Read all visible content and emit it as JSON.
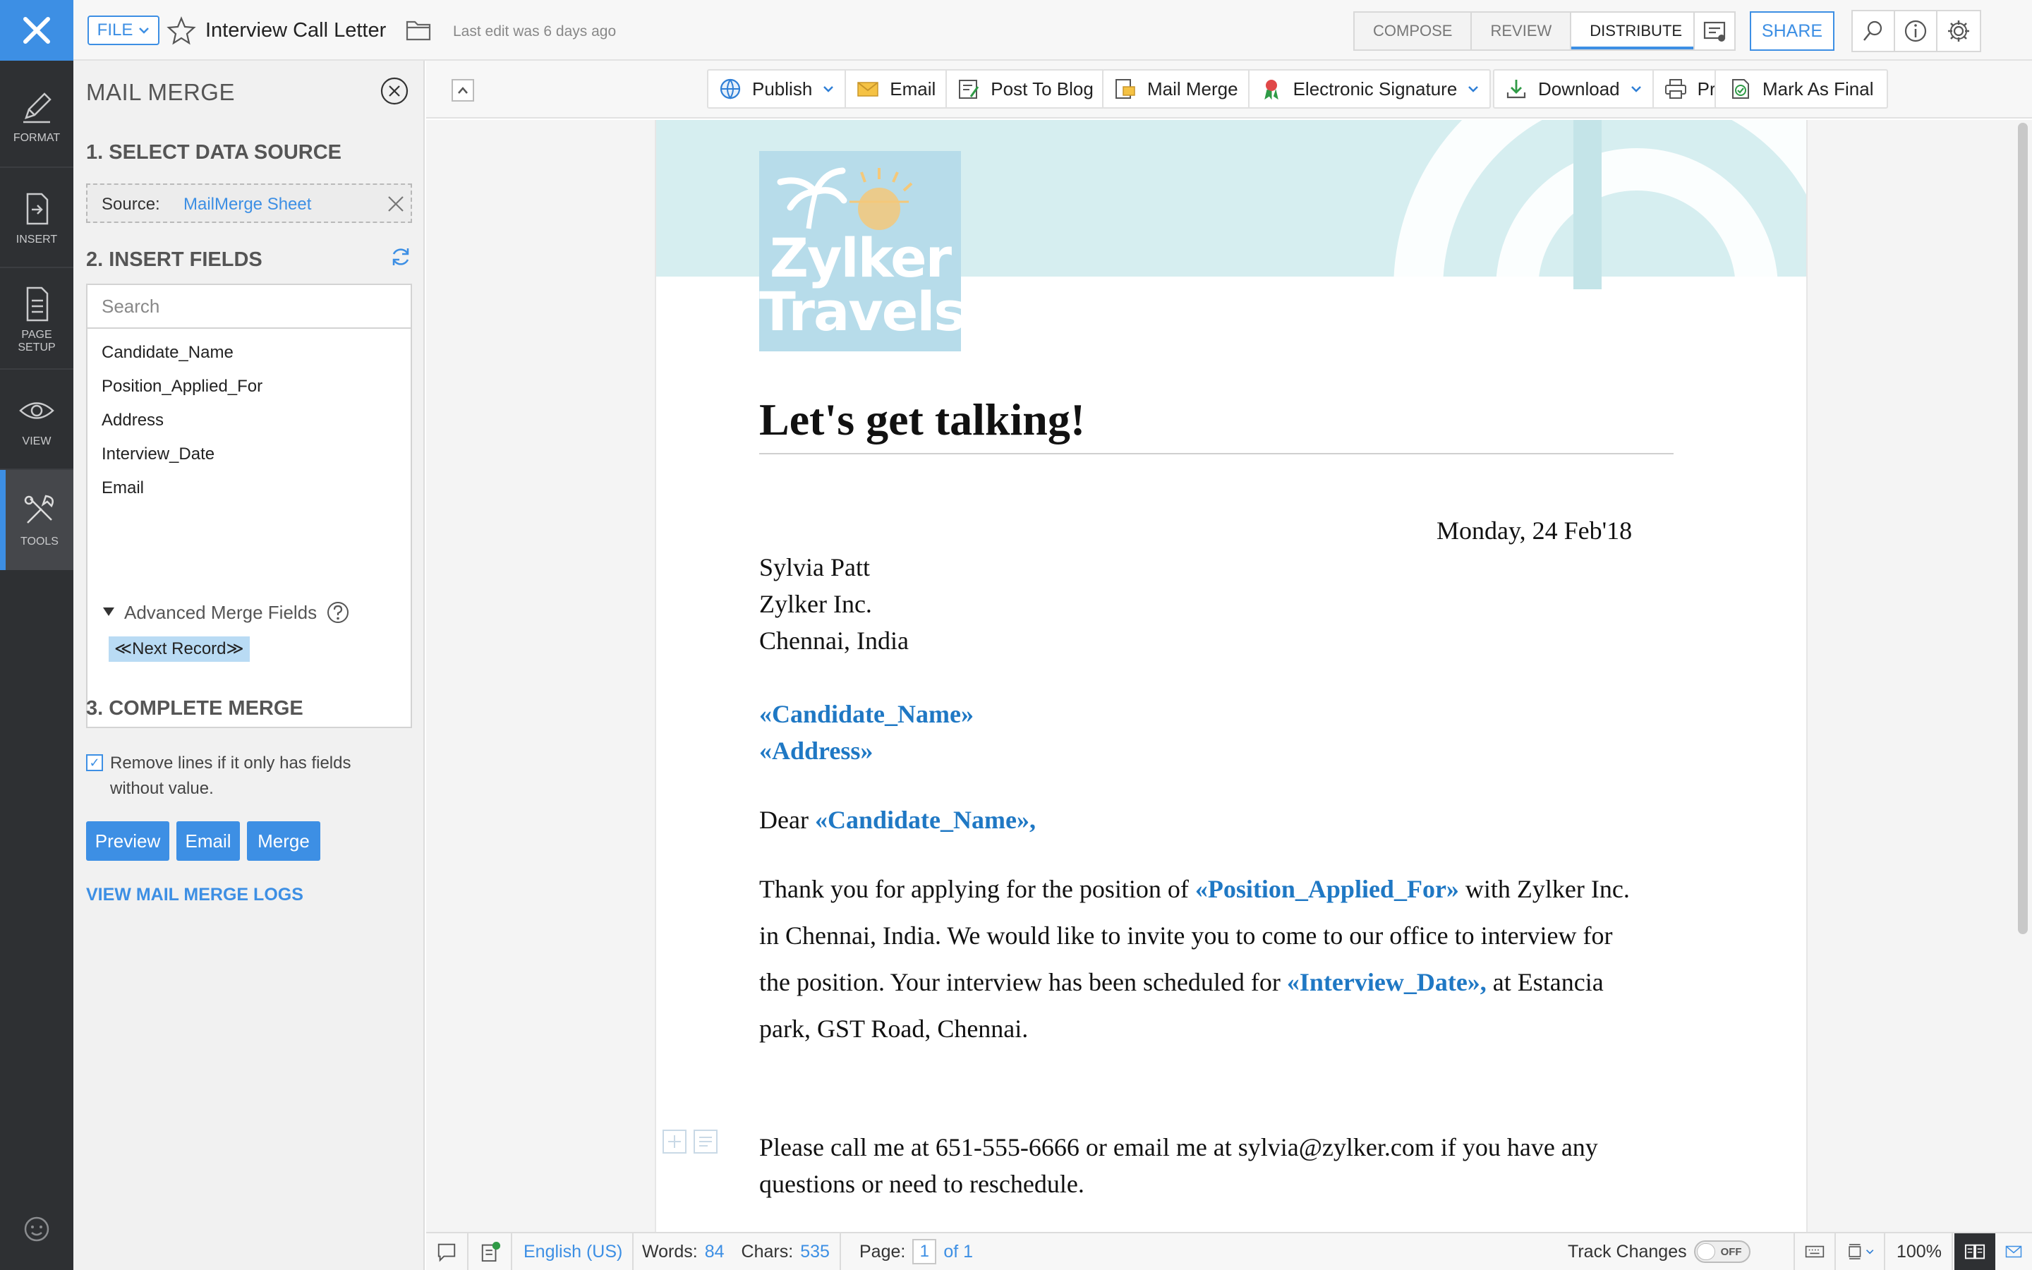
{
  "rail": {
    "items": [
      {
        "label": "FORMAT"
      },
      {
        "label": "INSERT"
      },
      {
        "label": "PAGE SETUP"
      },
      {
        "label": "VIEW"
      },
      {
        "label": "TOOLS"
      }
    ],
    "active": "TOOLS"
  },
  "header": {
    "file_label": "FILE",
    "doc_title": "Interview Call Letter",
    "last_edit": "Last edit was 6 days ago",
    "tabs": [
      {
        "label": "COMPOSE"
      },
      {
        "label": "REVIEW"
      },
      {
        "label": "DISTRIBUTE"
      }
    ],
    "active_tab": "DISTRIBUTE",
    "share_label": "SHARE"
  },
  "panel": {
    "title": "MAIL MERGE",
    "step1": "1. SELECT DATA SOURCE",
    "source_label": "Source:",
    "source_value": "MailMerge Sheet",
    "step2": "2. INSERT FIELDS",
    "search_placeholder": "Search",
    "fields": [
      "Candidate_Name",
      "Position_Applied_For",
      "Address",
      "Interview_Date",
      "Email"
    ],
    "advanced_title": "Advanced Merge Fields",
    "next_record": "≪Next Record≫",
    "step3": "3. COMPLETE MERGE",
    "remove_lines": "Remove lines if it only has fields without value.",
    "remove_lines_checked": true,
    "buttons": {
      "preview": "Preview",
      "email": "Email",
      "merge": "Merge"
    },
    "logs_link": "VIEW MAIL MERGE LOGS"
  },
  "toolbar": {
    "publish": "Publish",
    "email": "Email",
    "post_to_blog": "Post To Blog",
    "mail_merge": "Mail Merge",
    "electronic_signature": "Electronic Signature",
    "download": "Download",
    "print": "Print",
    "mark_as_final": "Mark As Final"
  },
  "document": {
    "logo_line1": "Zylker",
    "logo_line2": "Travels",
    "heading": "Let's get talking!",
    "date": "Monday, 24 Feb'18",
    "sender_name": "Sylvia Patt",
    "sender_company": "Zylker Inc.",
    "sender_location": "Chennai, India",
    "field_candidate_name": "«Candidate_Name»",
    "field_address": "«Address»",
    "dear": "Dear",
    "dear_field": "«Candidate_Name»,",
    "body_1": "Thank you for applying for the position of",
    "field_position": "«Position_Applied_For»",
    "body_2": "with Zylker Inc.",
    "body_line2": "in Chennai, India. We would like to invite you to come to our office to interview for",
    "body_line3_start": "the position. Your interview has been scheduled for",
    "field_interview_date": "«Interview_Date»,",
    "body_line3_end": "at Estancia",
    "body_line4": "park, GST Road, Chennai.",
    "contact_line1": "Please call me at 651-555-6666 or email me at sylvia@zylker.com if you have any",
    "contact_line2": "questions or need to reschedule."
  },
  "statusbar": {
    "language": "English (US)",
    "words_label": "Words:",
    "words_value": "84",
    "chars_label": "Chars:",
    "chars_value": "535",
    "page_label": "Page:",
    "page_value": "1",
    "page_of": "of 1",
    "track_changes": "Track Changes",
    "track_state": "OFF",
    "zoom": "100%"
  },
  "colors": {
    "accent": "#3d8fe4",
    "rail_bg": "#2e3033",
    "merge_field": "#1f78c4",
    "banner": "#d6eef0"
  }
}
